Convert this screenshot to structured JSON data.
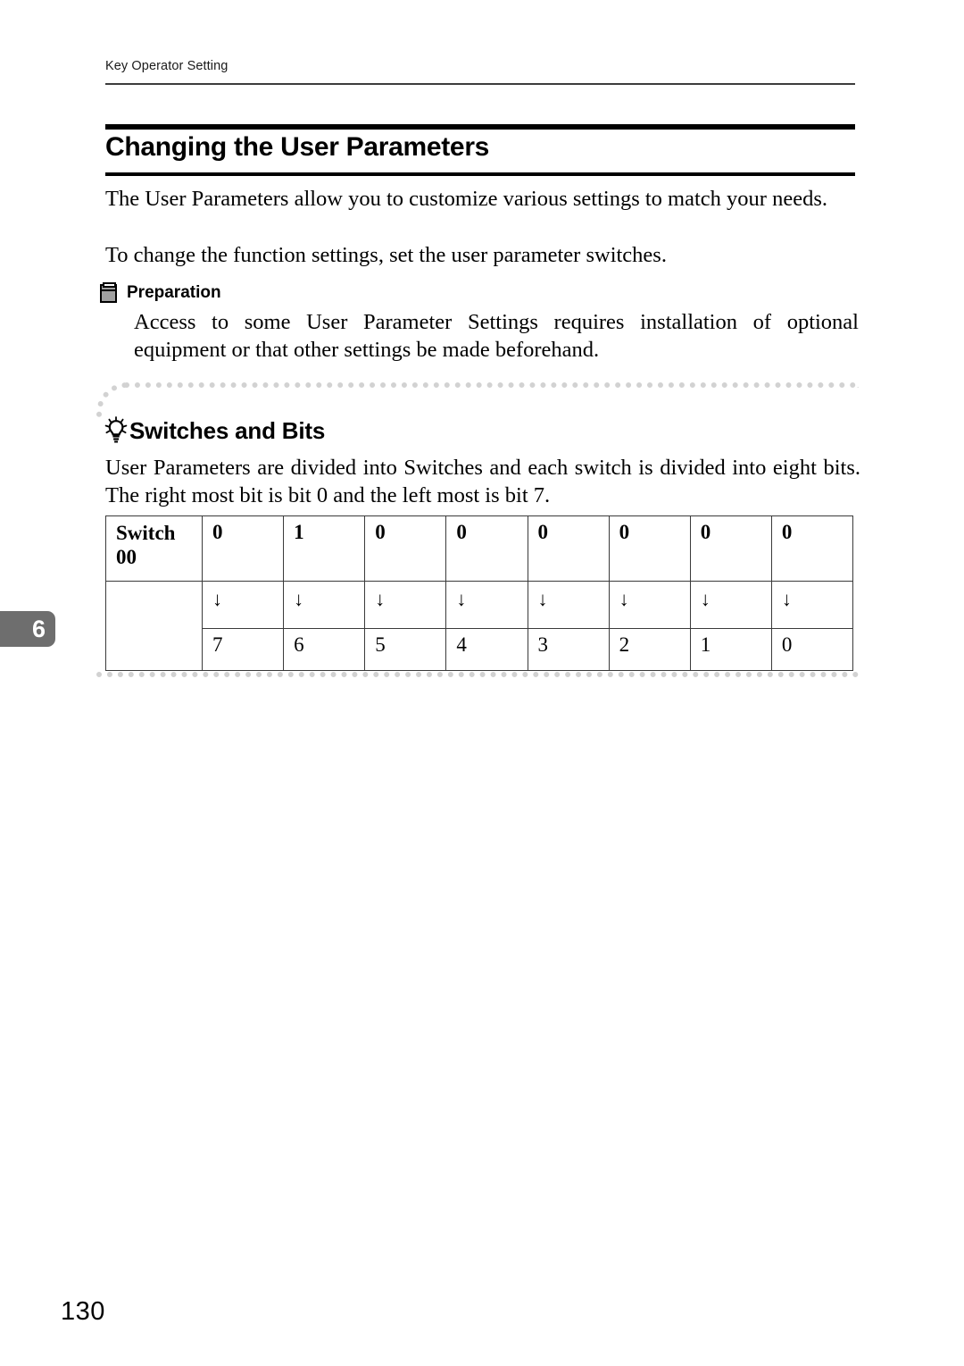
{
  "page": {
    "running_header": "Key Operator Setting",
    "page_number": "130",
    "chapter_tab": "6"
  },
  "section": {
    "title": "Changing the User Parameters",
    "paragraphs": {
      "intro": "The User Parameters allow you to customize various settings to match your needs.",
      "change": "To change the function settings, set the user parameter switches."
    }
  },
  "preparation": {
    "label": "Preparation",
    "icon": "book-icon",
    "text": "Access to some User Parameter Settings requires installation of optional equipment or that other settings be made beforehand."
  },
  "switches_section": {
    "heading": "Switches and Bits",
    "icon": "lightbulb-icon",
    "text": "User Parameters are divided into Switches and each switch is divided into eight bits. The right most bit is bit 0 and the left most is bit 7."
  },
  "bits_table": {
    "switch_label_line1": "Switch",
    "switch_label_line2": "00",
    "values": [
      "0",
      "1",
      "0",
      "0",
      "0",
      "0",
      "0",
      "0"
    ],
    "arrows": [
      "↓",
      "↓",
      "↓",
      "↓",
      "↓",
      "↓",
      "↓",
      "↓"
    ],
    "bits": [
      "7",
      "6",
      "5",
      "4",
      "3",
      "2",
      "1",
      "0"
    ]
  },
  "colors": {
    "rule": "#3c3c3c",
    "title_bar": "#000000",
    "dotted": "#d2d2d2",
    "chapter_tab_bg": "#6e6e6e",
    "table_border": "#3a3a3a"
  }
}
